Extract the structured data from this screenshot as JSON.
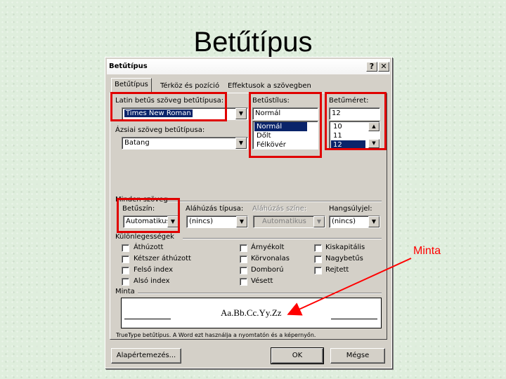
{
  "slide": {
    "title": "Betűtípus",
    "annotation": "Minta",
    "highlight_color": "#e00000"
  },
  "dialog": {
    "title": "Betűtípus",
    "help_button": "?",
    "close_button": "✕",
    "tabs": [
      {
        "label": "Betűtípus",
        "active": true
      },
      {
        "label": "Térköz és pozíció",
        "active": false
      },
      {
        "label": "Effektusok a szövegben",
        "active": false
      }
    ],
    "latin_font": {
      "label": "Latin betűs szöveg betűtípusa:",
      "value": "Times New Roman"
    },
    "asian_font": {
      "label": "Ázsiai szöveg betűtípusa:",
      "value": "Batang"
    },
    "font_style": {
      "label": "Betűstílus:",
      "value": "Normál",
      "options": [
        "Normál",
        "Dőlt",
        "Félkövér"
      ],
      "selected": "Normál"
    },
    "font_size": {
      "label": "Betűméret:",
      "value": "12",
      "options": [
        "10",
        "11",
        "12"
      ],
      "selected": "12"
    },
    "all_text_group": "Minden szöveg",
    "font_color": {
      "label": "Betűszín:",
      "value": "Automatikus"
    },
    "underline_type": {
      "label": "Aláhúzás típusa:",
      "value": "(nincs)"
    },
    "underline_color": {
      "label": "Aláhúzás színe:",
      "value": "Automatikus",
      "disabled": true
    },
    "emphasis": {
      "label": "Hangsúlyjel:",
      "value": "(nincs)"
    },
    "effects_group": "Különlegességek",
    "effects": {
      "strikethrough": "Áthúzott",
      "double_strikethrough": "Kétszer áthúzott",
      "superscript": "Felső index",
      "subscript": "Alsó index",
      "shadow": "Árnyékolt",
      "outline": "Körvonalas",
      "emboss": "Domború",
      "engrave": "Vésett",
      "small_caps": "Kiskapitális",
      "all_caps": "Nagybetűs",
      "hidden": "Rejtett"
    },
    "preview_group": "Minta",
    "preview_text": "Aa.Bb.Cc.Yy.Zz",
    "truetype_note": "TrueType betűtípus. A Word ezt használja a nyomtatón és a képernyőn.",
    "buttons": {
      "default": "Alapértemezés...",
      "ok": "OK",
      "cancel": "Mégse"
    }
  }
}
